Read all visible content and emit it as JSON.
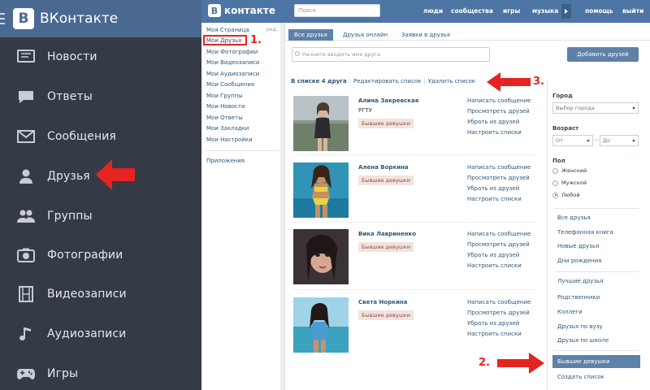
{
  "mobile": {
    "app_title": "ВКонтакте",
    "menu": [
      {
        "label": "Новости",
        "icon": "news-icon"
      },
      {
        "label": "Ответы",
        "icon": "answers-icon"
      },
      {
        "label": "Сообщения",
        "icon": "messages-icon"
      },
      {
        "label": "Друзья",
        "icon": "friends-icon"
      },
      {
        "label": "Группы",
        "icon": "groups-icon"
      },
      {
        "label": "Фотографии",
        "icon": "photos-icon"
      },
      {
        "label": "Видеозаписи",
        "icon": "video-icon"
      },
      {
        "label": "Аудиозаписи",
        "icon": "audio-icon"
      },
      {
        "label": "Игры",
        "icon": "games-icon"
      }
    ]
  },
  "vk": {
    "brand": "контакте",
    "brand_logo": "В",
    "search_placeholder": "Поиск",
    "top_nav": [
      "люди",
      "сообщества",
      "игры",
      "музыка",
      "помощь",
      "выйти"
    ],
    "left_menu": [
      "Моя Страница",
      "Мои Друзья",
      "Мои Фотографии",
      "Мои Видеозаписи",
      "Мои Аудиозаписи",
      "Мои Сообщения",
      "Мои Группы",
      "Мои Новости",
      "Мои Ответы",
      "Мои Закладки",
      "Мои Настройки"
    ],
    "left_edit": "ред.",
    "apps_link": "Приложения",
    "tabs": [
      "Все друзья",
      "Друзья онлайн",
      "Заявки в друзья"
    ],
    "friend_search_placeholder": "Начните вводить имя друга",
    "add_friends_label": "Добавить друзей",
    "list_header": {
      "count_text": "В списке 4 друга",
      "edit": "Редактировать список",
      "delete": "Удалить список"
    },
    "friends": [
      {
        "name": "Алина Закревская",
        "sub": "РГТУ",
        "tag": "Бывшие девушки"
      },
      {
        "name": "Алена Воркина",
        "sub": "",
        "tag": "Бывшие девушки"
      },
      {
        "name": "Вика Лавриненко",
        "sub": "",
        "tag": "Бывшие девушки"
      },
      {
        "name": "Света Норкина",
        "sub": "",
        "tag": "Бывшие девушки"
      }
    ],
    "friend_actions": [
      "Написать сообщение",
      "Просмотреть друзей",
      "Убрать из друзей",
      "Настроить списки"
    ],
    "filters": {
      "city_label": "Город",
      "city_value": "Выбор города",
      "age_label": "Возраст",
      "age_from": "От",
      "age_to": "До",
      "age_dash": "-",
      "sex_label": "Пол",
      "sex_options": [
        "Женский",
        "Мужской",
        "Любой"
      ],
      "sex_selected": "Любой",
      "lists_a": [
        "Все друзья",
        "Телефонная книга",
        "Новые друзья",
        "Дни рождения"
      ],
      "lists_b": [
        "Лучшие друзья",
        "Родственники",
        "Коллеги",
        "Друзья по вузу",
        "Друзья по школе"
      ],
      "selected_list": "Бывшие девушки",
      "create_list": "Создать список"
    }
  },
  "annotations": {
    "n1": "1.",
    "n2": "2.",
    "n3": "3."
  },
  "colors": {
    "vk_blue": "#4c75a3",
    "menu_dark": "#353b46",
    "annotation_red": "#e52421"
  }
}
